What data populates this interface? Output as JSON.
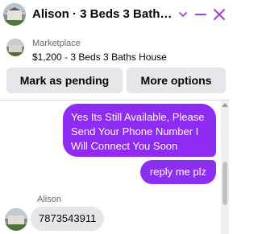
{
  "header": {
    "title": "Alison · 3 Beds 3 Baths Ho...",
    "avatar_icon": "listing-photo-house",
    "chevron_icon": "chevron-down-icon",
    "minimize_icon": "minimize-icon",
    "close_icon": "close-icon",
    "accent_color": "#a03ee8"
  },
  "listing": {
    "label": "Marketplace",
    "title": "$1,200 - 3 Beds 3 Baths House",
    "thumb_icon": "listing-photo-house"
  },
  "actions": {
    "pending_label": "Mark as pending",
    "more_label": "More options"
  },
  "messages": {
    "outgoing": [
      {
        "text": "Yes Its Still Available, Please Send Your Phone Number I Will Connect You Soon"
      },
      {
        "text": "reply me plz"
      }
    ],
    "incoming_sender": "Alison",
    "incoming": [
      {
        "text": "7873543911"
      }
    ],
    "outgoing_color": "#8d2ff3",
    "incoming_color": "#e4e6eb"
  }
}
